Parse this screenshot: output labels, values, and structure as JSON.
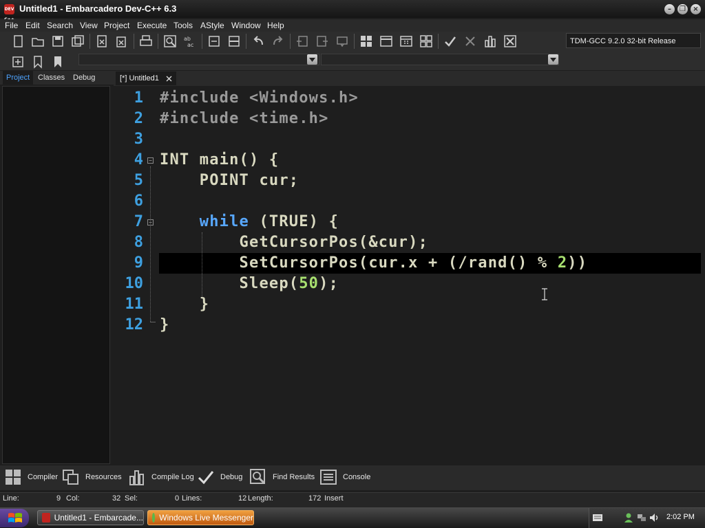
{
  "window": {
    "title": "Untitled1 - Embarcadero Dev-C++ 6.3",
    "app_icon_text": "DEV C++"
  },
  "menu": [
    "File",
    "Edit",
    "Search",
    "View",
    "Project",
    "Execute",
    "Tools",
    "AStyle",
    "Window",
    "Help"
  ],
  "toolbar": {
    "compiler_selected": "TDM-GCC 9.2.0 32-bit Release",
    "icons_row1": [
      "new-file-icon",
      "open-icon",
      "save-icon",
      "save-all-icon",
      "close-file-icon",
      "close-all-icon",
      "print-icon",
      "find-icon",
      "replace-icon",
      "toggle-comment-icon",
      "split-view-icon",
      "undo-icon",
      "redo-icon",
      "indent-icon",
      "unindent-icon",
      "compile-options-icon",
      "layout-1-icon",
      "layout-2-icon",
      "layout-3-icon",
      "layout-4-icon",
      "check-icon",
      "cross-icon",
      "chart-icon",
      "delete-icon"
    ],
    "icons_row2": [
      "insert-icon",
      "bookmark-icon",
      "goto-bookmark-icon"
    ]
  },
  "left_panel": {
    "tabs": [
      "Project",
      "Classes",
      "Debug"
    ],
    "active_tab": "Project"
  },
  "editor": {
    "tab_label": "[*] Untitled1",
    "lines": [
      {
        "num": "1",
        "text": "#include <Windows.h>"
      },
      {
        "num": "2",
        "text": "#include <time.h>"
      },
      {
        "num": "3",
        "text": ""
      },
      {
        "num": "4",
        "text": "INT main() {"
      },
      {
        "num": "5",
        "text": "    POINT cur;"
      },
      {
        "num": "6",
        "text": ""
      },
      {
        "num": "7",
        "text": "    while (TRUE) {"
      },
      {
        "num": "8",
        "text": "        GetCursorPos(&cur);"
      },
      {
        "num": "9",
        "text": "        SetCursorPos(cur.x + (/rand() % 2))"
      },
      {
        "num": "10",
        "text": "        Sleep(50);"
      },
      {
        "num": "11",
        "text": "    }"
      },
      {
        "num": "12",
        "text": "}"
      }
    ]
  },
  "bottom_tabs": [
    "Compiler",
    "Resources",
    "Compile Log",
    "Debug",
    "Find Results",
    "Console"
  ],
  "status": {
    "line_label": "Line:",
    "line_value": "9",
    "col_label": "Col:",
    "col_value": "32",
    "sel_label": "Sel:",
    "sel_value": "0",
    "lines_label": "Lines:",
    "lines_value": "12",
    "length_label": "Length:",
    "length_value": "172",
    "mode": "Insert"
  },
  "taskbar": {
    "tasks": [
      "Untitled1 - Embarcade...",
      "Windows Live Messenger"
    ],
    "clock": "2:02 PM"
  }
}
